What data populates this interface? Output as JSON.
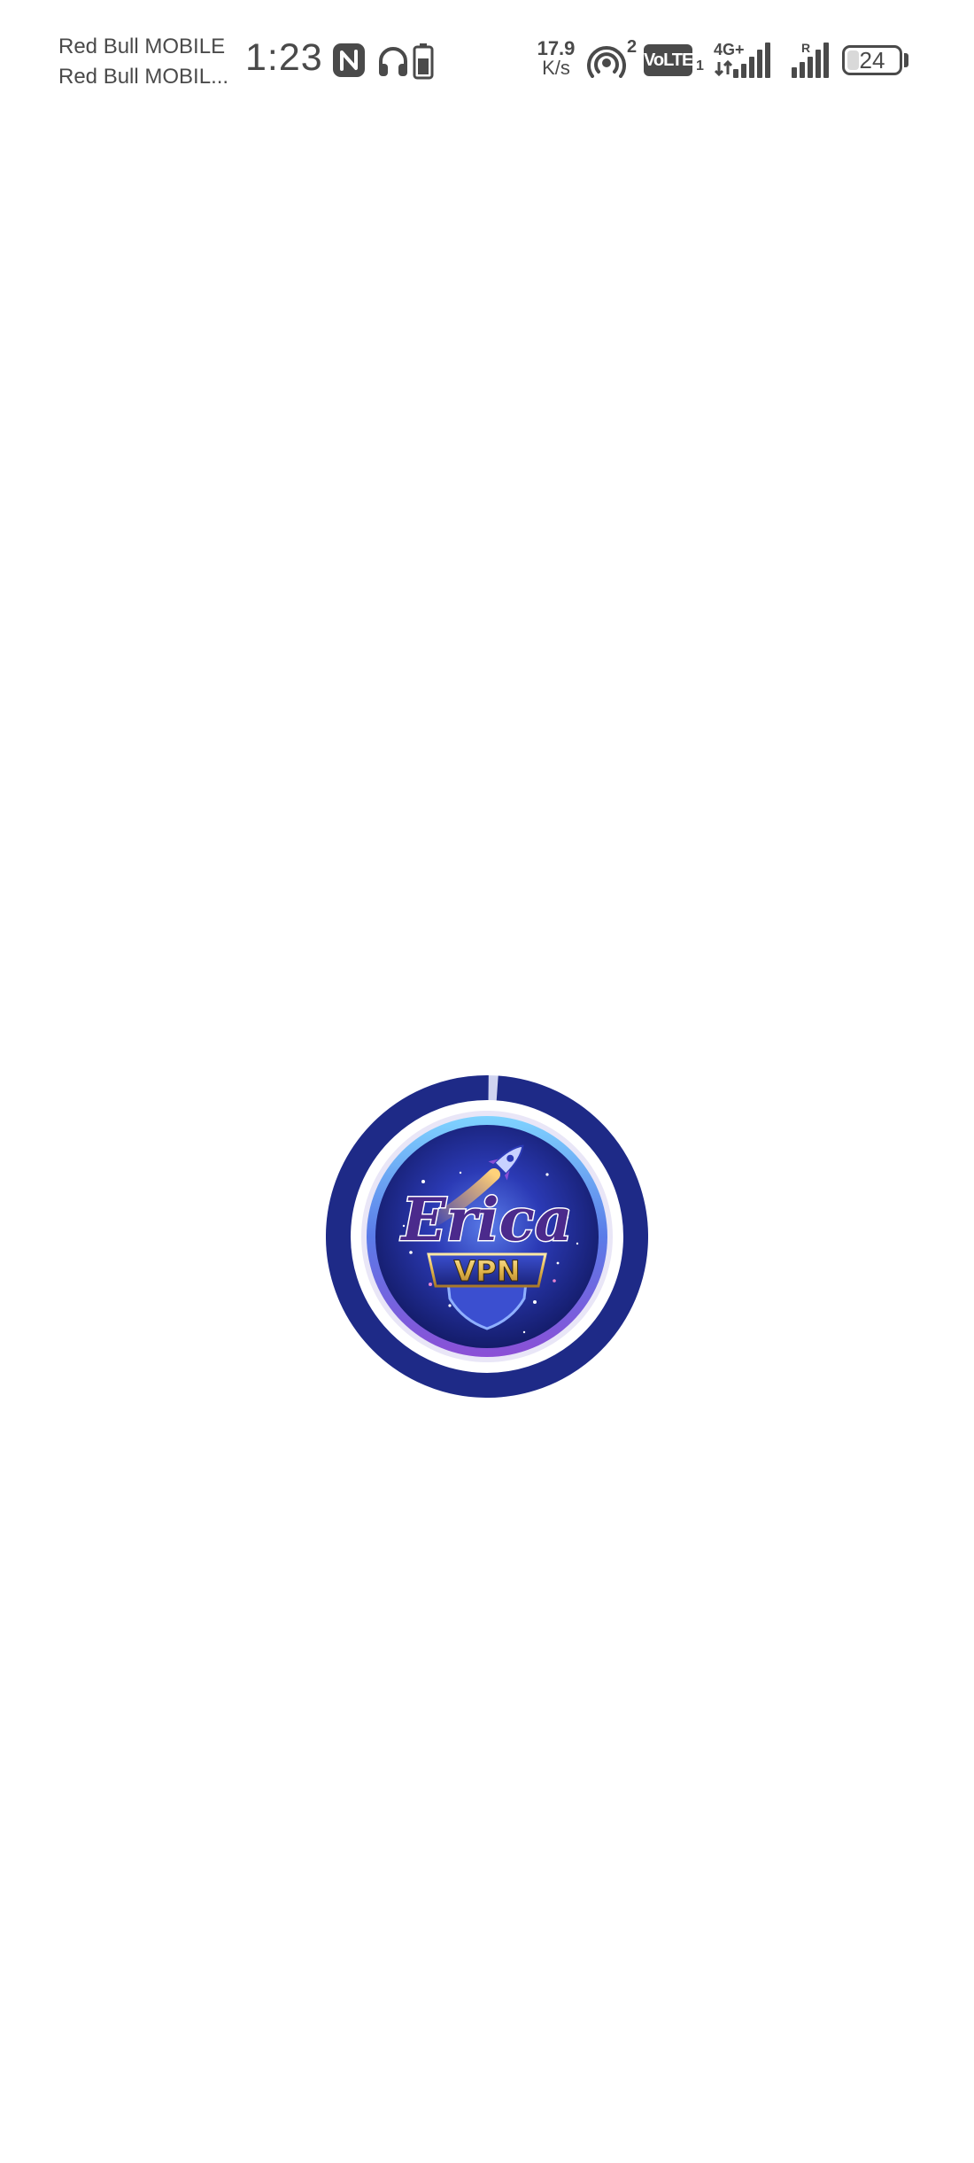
{
  "status_bar": {
    "carrier_1": "Red Bull MOBILE",
    "carrier_2": "Red Bull MOBIL...",
    "time": "1:23",
    "net_speed_value": "17.9",
    "net_speed_unit": "K/s",
    "hotspot_devices": "2",
    "volte_label": "VoLTE",
    "sim_slot": "1",
    "network_type": "4G+",
    "roaming_label": "R",
    "battery_level": "24",
    "battery_fraction": 0.24,
    "icons": [
      "nfc-icon",
      "headphones-icon",
      "battery-saver-icon",
      "hotspot-icon",
      "signal-bars-icon",
      "signal-bars-roaming-icon",
      "battery-icon"
    ]
  },
  "splash": {
    "logo_text": "Erica",
    "logo_subtext": "VPN",
    "loading_progress": 0.99,
    "colors": {
      "ring": "#1e2a87",
      "ring_gap": "#cfd3f0",
      "logo_inner": "#2b3ab5",
      "logo_gold": "#e2b64a",
      "logo_purple": "#4b2a8c"
    }
  }
}
